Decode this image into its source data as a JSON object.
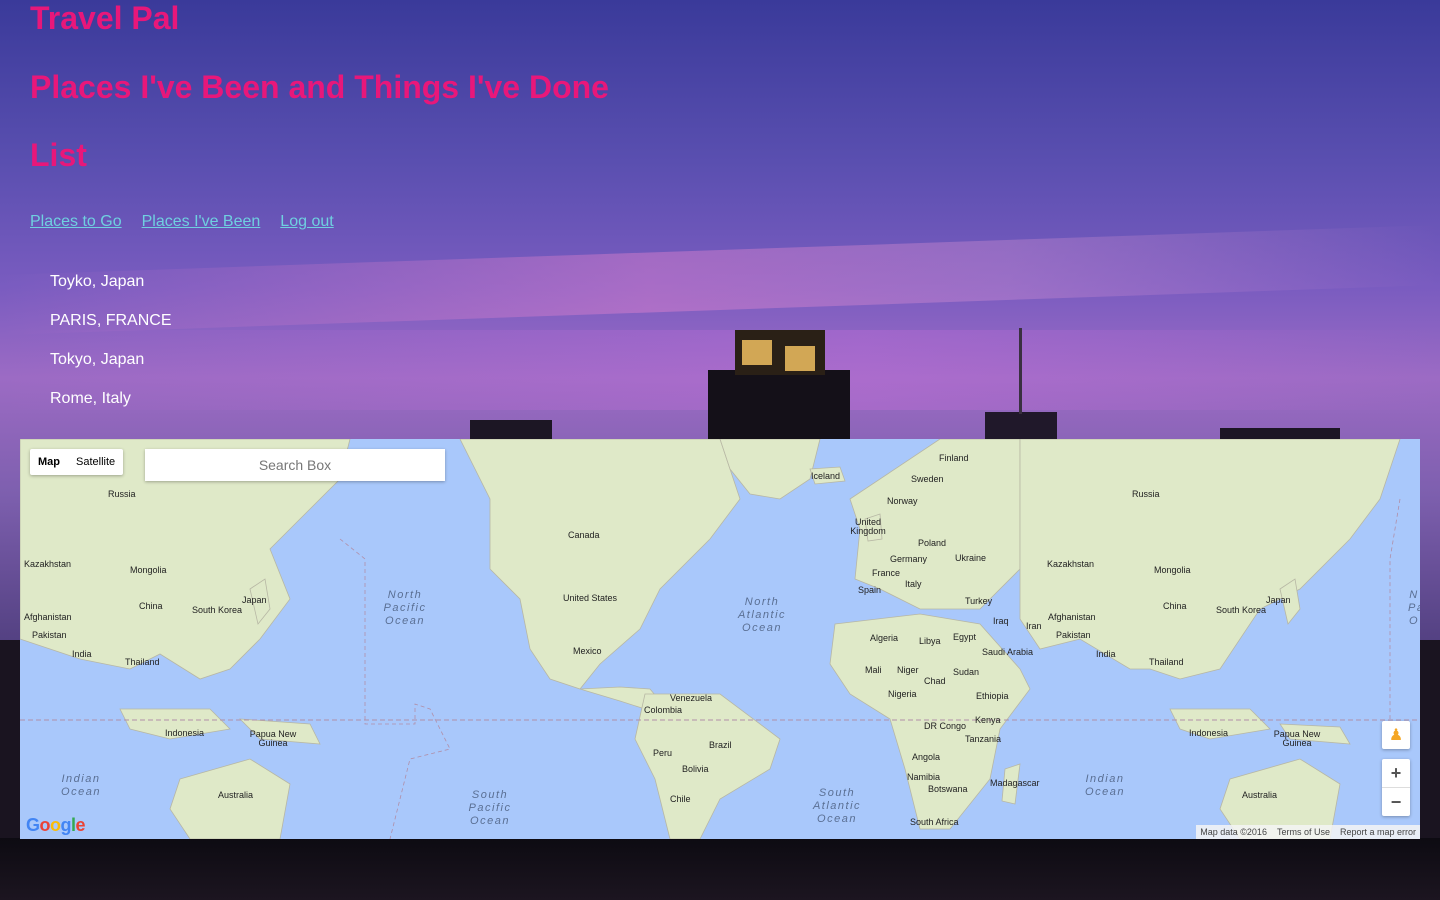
{
  "header": {
    "app_title": "Travel Pal",
    "subtitle": "Places I've Been and Things I've Done",
    "section_title": "List"
  },
  "nav": {
    "places_to_go": "Places to Go",
    "places_been": "Places I've Been",
    "logout": "Log out"
  },
  "places": [
    "Toyko, Japan",
    "PARIS, FRANCE",
    "Tokyo, Japan",
    "Rome, Italy"
  ],
  "map": {
    "type_map": "Map",
    "type_satellite": "Satellite",
    "search_placeholder": "Search Box",
    "labels": {
      "russia_w": "Russia",
      "kazakhstan_w": "Kazakhstan",
      "mongolia_w": "Mongolia",
      "afghanistan_w": "Afghanistan",
      "pakistan_w": "Pakistan",
      "india_w": "India",
      "china_w": "China",
      "south_korea_w": "South Korea",
      "japan_w": "Japan",
      "thailand_w": "Thailand",
      "indonesia_w": "Indonesia",
      "png_w": "Papua New Guinea",
      "australia_w": "Australia",
      "canada": "Canada",
      "us": "United States",
      "mexico": "Mexico",
      "venezuela": "Venezuela",
      "colombia": "Colombia",
      "peru": "Peru",
      "brazil": "Brazil",
      "bolivia": "Bolivia",
      "chile": "Chile",
      "iceland": "Iceland",
      "finland": "Finland",
      "sweden": "Sweden",
      "norway": "Norway",
      "uk": "United Kingdom",
      "poland": "Poland",
      "germany": "Germany",
      "ukraine": "Ukraine",
      "france": "France",
      "italy": "Italy",
      "spain": "Spain",
      "turkey": "Turkey",
      "algeria": "Algeria",
      "libya": "Libya",
      "egypt": "Egypt",
      "iraq": "Iraq",
      "iran": "Iran",
      "saudi": "Saudi Arabia",
      "mali": "Mali",
      "niger": "Niger",
      "chad": "Chad",
      "sudan": "Sudan",
      "nigeria": "Nigeria",
      "ethiopia": "Ethiopia",
      "drc": "DR Congo",
      "kenya": "Kenya",
      "tanzania": "Tanzania",
      "angola": "Angola",
      "namibia": "Namibia",
      "botswana": "Botswana",
      "madagascar": "Madagascar",
      "south_africa": "South Africa",
      "russia_e": "Russia",
      "kazakhstan_e": "Kazakhstan",
      "mongolia_e": "Mongolia",
      "afghanistan_e": "Afghanistan",
      "pakistan_e": "Pakistan",
      "india_e": "India",
      "china_e": "China",
      "south_korea_e": "South Korea",
      "japan_e": "Japan",
      "thailand_e": "Thailand",
      "indonesia_e": "Indonesia",
      "png_e": "Papua New Guinea",
      "australia_e": "Australia"
    },
    "oceans": {
      "n_pacific": "North Pacific Ocean",
      "s_pacific": "South Pacific Ocean",
      "n_atlantic": "North Atlantic Ocean",
      "s_atlantic": "South Atlantic Ocean",
      "indian_w": "Indian Ocean",
      "indian_e": "Indian Ocean",
      "np_edge": "N Pa O"
    },
    "google": "Google",
    "attribution": {
      "data": "Map data ©2016",
      "terms": "Terms of Use",
      "report": "Report a map error"
    }
  },
  "colors": {
    "title": "#e8177a",
    "link": "#6fd0e0",
    "ocean": "#a9c8fb",
    "land": "#dfe9c8"
  }
}
